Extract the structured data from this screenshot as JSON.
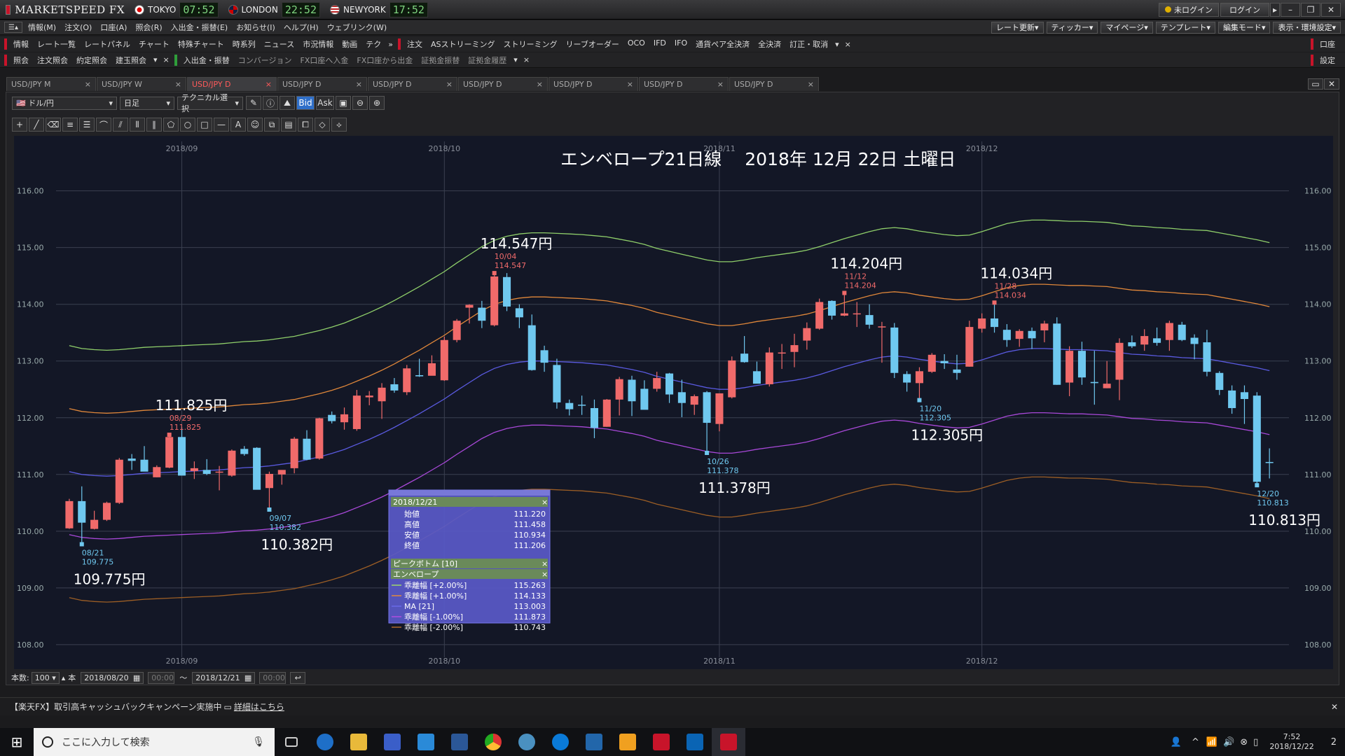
{
  "app": {
    "title": "MARKETSPEED FX"
  },
  "clocks": [
    {
      "city": "TOKYO",
      "time": "07:52",
      "flag": "jp"
    },
    {
      "city": "LONDON",
      "time": "22:52",
      "flag": "uk"
    },
    {
      "city": "NEWYORK",
      "time": "17:52",
      "flag": "us"
    }
  ],
  "titlebar": {
    "login_status": "未ログイン",
    "login_button": "ログイン"
  },
  "menu": [
    "情報(M)",
    "注文(O)",
    "口座(A)",
    "照会(R)",
    "入出金・振替(E)",
    "お知らせ(I)",
    "ヘルプ(H)",
    "ウェブリンク(W)"
  ],
  "menu_right": [
    "レート更新",
    "ティッカー",
    "マイページ",
    "テンプレート",
    "編集モード",
    "表示・環境設定"
  ],
  "toolbar1": {
    "info": [
      "情報",
      "レート一覧",
      "レートパネル",
      "チャート",
      "特殊チャート",
      "時系列",
      "ニュース",
      "市況情報",
      "動画",
      "テク"
    ],
    "order": [
      "注文",
      "ASストリーミング",
      "ストリーミング",
      "リーブオーダー",
      "OCO",
      "IFD",
      "IFO",
      "通貨ペア全決済",
      "全決済",
      "訂正・取消"
    ],
    "right": "口座"
  },
  "toolbar2": {
    "query": [
      "照会",
      "注文照会",
      "約定照会",
      "建玉照会"
    ],
    "transfer": [
      "入出金・振替",
      "コンバージョン",
      "FX口座へ入金",
      "FX口座から出金",
      "証拠金振替",
      "証拠金履歴"
    ],
    "right": "設定"
  },
  "tabs": [
    "USD/JPY M",
    "USD/JPY W",
    "USD/JPY D",
    "USD/JPY D",
    "USD/JPY D",
    "USD/JPY D",
    "USD/JPY D",
    "USD/JPY D",
    "USD/JPY D"
  ],
  "active_tab": 2,
  "chart_controls": {
    "pair": "ドル/円",
    "period": "日足",
    "technical": "テクニカル選択",
    "bid": "Bid",
    "ask": "Ask"
  },
  "bottom": {
    "count_label": "本数:",
    "count": "100",
    "unit": "本",
    "from": "2018/08/20",
    "time_from": "00:00",
    "tilde": "〜",
    "to": "2018/12/21",
    "time_to": "00:00"
  },
  "news": {
    "text": "【楽天FX】取引高キャッシュバックキャンペーン実施中",
    "link": "詳細はこちら"
  },
  "taskbar": {
    "search_placeholder": "ここに入力して検索",
    "time": "7:52",
    "date": "2018/12/22",
    "notif": "2"
  },
  "tooltip": {
    "date": "2018/12/21",
    "ohlc": [
      {
        "k": "始値",
        "v": "111.220"
      },
      {
        "k": "高値",
        "v": "111.458"
      },
      {
        "k": "安値",
        "v": "110.934"
      },
      {
        "k": "終値",
        "v": "111.206"
      }
    ],
    "peak": "ピークボトム [10]",
    "env": "エンベロープ",
    "lines": [
      {
        "k": "乖離幅 [+2.00%]",
        "v": "115.263",
        "c": "#9fd66b"
      },
      {
        "k": "乖離幅 [+1.00%]",
        "v": "114.133",
        "c": "#e38a3c"
      },
      {
        "k": "MA [21]",
        "v": "113.003",
        "c": "#6a6ae8"
      },
      {
        "k": "乖離幅 [-1.00%]",
        "v": "111.873",
        "c": "#b04de0"
      },
      {
        "k": "乖離幅 [-2.00%]",
        "v": "110.743",
        "c": "#b06a2a"
      }
    ]
  },
  "chart_data": {
    "type": "candlestick",
    "title": "エンベロープ21日線　 2018年 12月 22日 土曜日",
    "ylim": [
      108.0,
      116.0
    ],
    "yticks": [
      "108.00",
      "109.00",
      "110.00",
      "111.00",
      "112.00",
      "113.00",
      "114.00",
      "115.00",
      "116.00"
    ],
    "months": [
      {
        "label": "2018/09",
        "i": 9
      },
      {
        "label": "2018/10",
        "i": 30
      },
      {
        "label": "2018/11",
        "i": 52
      },
      {
        "label": "2018/12",
        "i": 73
      }
    ],
    "colors": {
      "up": "#f06a6a",
      "down": "#6fc8ef"
    },
    "candles": [
      [
        110.05,
        110.57,
        110.04,
        110.53
      ],
      [
        110.53,
        110.79,
        109.77,
        110.15
      ],
      [
        110.04,
        110.36,
        110.03,
        110.2
      ],
      [
        110.2,
        110.52,
        110.18,
        110.5
      ],
      [
        110.5,
        111.29,
        110.48,
        111.26
      ],
      [
        111.28,
        111.36,
        111.08,
        111.24
      ],
      [
        111.26,
        111.5,
        111.07,
        111.05
      ],
      [
        110.95,
        111.16,
        110.95,
        111.13
      ],
      [
        111.12,
        111.7,
        111.11,
        111.66
      ],
      [
        111.66,
        111.83,
        110.99,
        110.98
      ],
      [
        111.06,
        111.23,
        110.92,
        111.11
      ],
      [
        111.08,
        111.27,
        110.99,
        111.01
      ],
      [
        111.05,
        111.15,
        110.72,
        111.05
      ],
      [
        110.98,
        111.44,
        110.96,
        111.42
      ],
      [
        111.45,
        111.5,
        111.33,
        111.36
      ],
      [
        111.47,
        111.48,
        110.88,
        110.73
      ],
      [
        110.76,
        111.05,
        110.38,
        111.01
      ],
      [
        111.0,
        111.07,
        110.82,
        111.08
      ],
      [
        111.11,
        111.66,
        111.02,
        111.63
      ],
      [
        111.63,
        111.78,
        111.25,
        111.26
      ],
      [
        111.28,
        112.0,
        111.26,
        111.99
      ],
      [
        112.05,
        112.11,
        111.9,
        111.94
      ],
      [
        111.92,
        112.18,
        111.79,
        112.06
      ],
      [
        111.8,
        112.49,
        111.77,
        112.39
      ],
      [
        112.36,
        112.47,
        112.22,
        112.39
      ],
      [
        112.29,
        112.61,
        111.98,
        112.53
      ],
      [
        112.59,
        112.7,
        112.44,
        112.48
      ],
      [
        112.45,
        112.93,
        112.4,
        112.87
      ],
      [
        112.75,
        113.04,
        112.72,
        112.73
      ],
      [
        112.74,
        113.1,
        112.77,
        112.96
      ],
      [
        112.66,
        113.43,
        112.65,
        113.37
      ],
      [
        113.37,
        113.74,
        113.33,
        113.71
      ],
      [
        113.94,
        114.0,
        113.66,
        113.99
      ],
      [
        113.94,
        114.06,
        113.58,
        113.71
      ],
      [
        113.63,
        114.55,
        113.61,
        114.49
      ],
      [
        114.48,
        114.55,
        113.88,
        113.96
      ],
      [
        113.93,
        114.0,
        113.58,
        113.77
      ],
      [
        113.63,
        113.82,
        112.83,
        112.84
      ],
      [
        113.19,
        113.27,
        112.81,
        112.97
      ],
      [
        112.93,
        113.04,
        112.16,
        112.27
      ],
      [
        112.26,
        112.32,
        112.04,
        112.15
      ],
      [
        112.23,
        112.39,
        112.05,
        112.22
      ],
      [
        112.17,
        112.32,
        111.64,
        111.82
      ],
      [
        111.84,
        112.33,
        111.84,
        112.32
      ],
      [
        112.32,
        112.72,
        112.04,
        112.68
      ],
      [
        112.67,
        112.74,
        112.03,
        112.29
      ],
      [
        112.51,
        112.66,
        112.16,
        112.14
      ],
      [
        112.51,
        112.81,
        112.46,
        112.7
      ],
      [
        112.78,
        112.79,
        112.26,
        112.41
      ],
      [
        112.45,
        112.67,
        112.01,
        112.26
      ],
      [
        112.23,
        112.41,
        112.05,
        112.38
      ],
      [
        112.45,
        112.47,
        111.38,
        111.91
      ],
      [
        111.89,
        112.41,
        111.76,
        112.43
      ],
      [
        112.36,
        113.08,
        112.34,
        113.01
      ],
      [
        113.13,
        113.44,
        112.97,
        112.98
      ],
      [
        112.82,
        112.99,
        112.67,
        112.6
      ],
      [
        112.59,
        113.24,
        112.55,
        113.15
      ],
      [
        113.15,
        113.3,
        112.86,
        113.15
      ],
      [
        113.16,
        113.48,
        112.89,
        113.28
      ],
      [
        113.36,
        113.68,
        113.2,
        113.58
      ],
      [
        113.57,
        114.1,
        113.55,
        114.04
      ],
      [
        114.06,
        114.07,
        113.73,
        113.8
      ],
      [
        113.8,
        114.2,
        113.79,
        113.84
      ],
      [
        113.83,
        114.04,
        113.6,
        113.84
      ],
      [
        113.81,
        114.0,
        113.57,
        113.64
      ],
      [
        113.61,
        113.69,
        112.97,
        113.61
      ],
      [
        113.59,
        113.67,
        112.7,
        112.79
      ],
      [
        112.77,
        112.82,
        112.46,
        112.62
      ],
      [
        112.61,
        112.89,
        112.31,
        112.82
      ],
      [
        112.81,
        113.14,
        112.79,
        113.11
      ],
      [
        113.0,
        113.12,
        112.86,
        112.96
      ],
      [
        112.85,
        113.11,
        112.67,
        112.79
      ],
      [
        112.9,
        113.71,
        112.9,
        113.6
      ],
      [
        113.57,
        113.84,
        113.5,
        113.75
      ],
      [
        113.75,
        114.03,
        113.5,
        113.6
      ],
      [
        113.55,
        113.65,
        113.25,
        113.37
      ],
      [
        113.39,
        113.56,
        113.25,
        113.53
      ],
      [
        113.53,
        113.59,
        113.21,
        113.4
      ],
      [
        113.54,
        113.71,
        113.33,
        113.66
      ],
      [
        113.66,
        113.77,
        112.58,
        112.58
      ],
      [
        112.62,
        113.26,
        112.38,
        113.18
      ],
      [
        113.18,
        113.34,
        112.58,
        112.71
      ],
      [
        112.63,
        113.18,
        112.23,
        112.61
      ],
      [
        112.52,
        113.0,
        112.52,
        112.6
      ],
      [
        112.67,
        113.4,
        112.31,
        113.32
      ],
      [
        113.33,
        113.45,
        113.23,
        113.26
      ],
      [
        113.29,
        113.56,
        113.18,
        113.44
      ],
      [
        113.4,
        113.59,
        113.27,
        113.32
      ],
      [
        113.37,
        113.71,
        113.18,
        113.67
      ],
      [
        113.64,
        113.69,
        113.35,
        113.37
      ],
      [
        113.41,
        113.47,
        113.03,
        113.3
      ],
      [
        113.33,
        113.55,
        112.73,
        112.81
      ],
      [
        112.79,
        112.82,
        112.4,
        112.49
      ],
      [
        112.48,
        112.57,
        112.07,
        112.17
      ],
      [
        112.45,
        112.57,
        111.89,
        112.33
      ],
      [
        112.39,
        112.45,
        110.81,
        110.87
      ],
      [
        111.22,
        111.46,
        110.93,
        111.21
      ]
    ],
    "annotations": [
      {
        "i": 1,
        "side": "low",
        "date": "08/21",
        "price": "109.775",
        "big": "109.775円",
        "color": "#6fc8ef"
      },
      {
        "i": 16,
        "side": "low",
        "date": "09/07",
        "price": "110.382",
        "big": "110.382円",
        "color": "#6fc8ef"
      },
      {
        "i": 8,
        "side": "high",
        "date": "08/29",
        "price": "111.825",
        "big": "111.825円",
        "color": "#f06a6a"
      },
      {
        "i": 34,
        "side": "high",
        "date": "10/04",
        "price": "114.547",
        "big": "114.547円",
        "color": "#f06a6a"
      },
      {
        "i": 51,
        "side": "low",
        "date": "10/26",
        "price": "111.378",
        "big": "111.378円",
        "color": "#6fc8ef"
      },
      {
        "i": 62,
        "side": "high",
        "date": "11/12",
        "price": "114.204",
        "big": "114.204円",
        "color": "#f06a6a"
      },
      {
        "i": 68,
        "side": "low",
        "date": "11/20",
        "price": "112.305",
        "big": "112.305円",
        "color": "#6fc8ef"
      },
      {
        "i": 74,
        "side": "high",
        "date": "11/28",
        "price": "114.034",
        "big": "114.034円",
        "color": "#f06a6a"
      },
      {
        "i": 95,
        "side": "low",
        "date": "12/20",
        "price": "110.813",
        "big": "110.813円",
        "color": "#6fc8ef"
      }
    ],
    "ma21": [
      111.05,
      111.0,
      110.98,
      110.97,
      110.98,
      111.0,
      111.02,
      111.03,
      111.04,
      111.05,
      111.06,
      111.07,
      111.08,
      111.1,
      111.12,
      111.13,
      111.15,
      111.18,
      111.21,
      111.26,
      111.31,
      111.37,
      111.44,
      111.53,
      111.62,
      111.72,
      111.83,
      111.95,
      112.07,
      112.2,
      112.33,
      112.48,
      112.62,
      112.76,
      112.87,
      112.94,
      112.98,
      113.0,
      113.0,
      112.99,
      112.98,
      112.97,
      112.95,
      112.93,
      112.89,
      112.85,
      112.8,
      112.73,
      112.68,
      112.63,
      112.58,
      112.53,
      112.5,
      112.5,
      112.53,
      112.57,
      112.6,
      112.63,
      112.66,
      112.7,
      112.76,
      112.83,
      112.9,
      112.96,
      113.02,
      113.07,
      113.09,
      113.07,
      113.03,
      113.0,
      112.97,
      112.95,
      112.96,
      113.02,
      113.09,
      113.16,
      113.2,
      113.22,
      113.22,
      113.21,
      113.2,
      113.2,
      113.19,
      113.18,
      113.15,
      113.12,
      113.11,
      113.09,
      113.08,
      113.06,
      113.05,
      113.04,
      113.0,
      112.96,
      112.92,
      112.88,
      112.83
    ]
  }
}
